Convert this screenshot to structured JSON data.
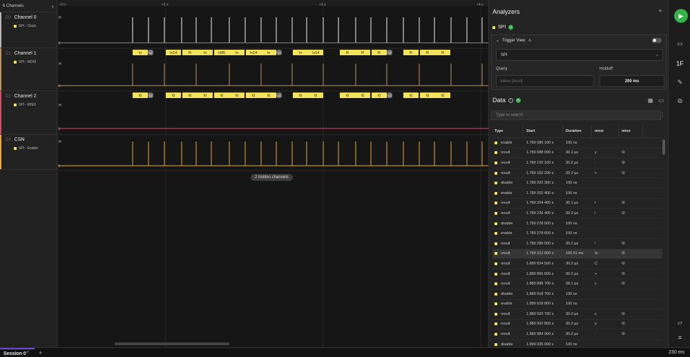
{
  "channels_header": {
    "count_label": "6 Channels",
    "collapse_icon": "chevron-left-icon"
  },
  "channels": [
    {
      "index": "D0",
      "name": "Channel 0",
      "analyzer": "SPI - Clock",
      "color": "#b8b8b8"
    },
    {
      "index": "D1",
      "name": "Channel 1",
      "analyzer": "SPI - MOSI",
      "color": "#c49860"
    },
    {
      "index": "D2",
      "name": "Channel 2",
      "analyzer": "SPI - MISO",
      "color": "#e04c64"
    },
    {
      "index": "D3",
      "name": "CSN",
      "analyzer": "SPI - Enable",
      "color": "#f0a93a"
    }
  ],
  "timeline": {
    "ticks": [
      "+0 s",
      "+2 s",
      "+3 s",
      "+4 s"
    ],
    "level_labels": {
      "high": "H",
      "low": "L"
    }
  },
  "mosi_frames": [
    "\\n",
    "\\x14",
    "R",
    "\\n",
    "\\x85",
    "\\n",
    "\\x14",
    "\\n",
    "\\n",
    "\\x14",
    "R",
    "R",
    "R",
    "R",
    "R",
    "R"
  ],
  "miso_frames": [
    "\\0",
    "\\0",
    "\\0",
    "\\0",
    "\\0",
    "\\0",
    "\\0",
    "\\0",
    "\\0",
    "\\0",
    "\\0",
    "\\0",
    "\\0",
    "\\0",
    "\\0",
    "\\0"
  ],
  "badge_label": "13",
  "hidden_channels_label": "2 hidden channels",
  "analyzers": {
    "title": "Analyzers",
    "add_icon": "plus-icon",
    "spi_label": "SPI",
    "trigger_view_label": "Trigger View",
    "trigger_select_value": "SPI",
    "query_label": "Query",
    "query_placeholder": "Value [Ascii]",
    "holdoff_label": "Holdoff",
    "holdoff_value": "200 ms"
  },
  "data_panel": {
    "title": "Data",
    "search_placeholder": "Type to search",
    "columns": [
      "Type",
      "Start",
      "Duration",
      "mosi",
      "miso"
    ],
    "rows": [
      {
        "type": "enable",
        "start": "1.789 086 100 s",
        "duration": "100 ns",
        "mosi": "",
        "miso": ""
      },
      {
        "type": "result",
        "start": "1.789 088 000 s",
        "duration": "30.2 µs",
        "mosi": "y",
        "miso": "\\0"
      },
      {
        "type": "result",
        "start": "1.789 120 100 s",
        "duration": "30.2 µs",
        "mosi": ".",
        "miso": "\\0"
      },
      {
        "type": "result",
        "start": "1.789 152 200 s",
        "duration": "30.2 µs",
        "mosi": "+",
        "miso": "\\0"
      },
      {
        "type": "disable",
        "start": "1.789 202 300 s",
        "duration": "100 ns",
        "mosi": "",
        "miso": ""
      },
      {
        "type": "enable",
        "start": "1.789 202 400 s",
        "duration": "100 ns",
        "mosi": "",
        "miso": ""
      },
      {
        "type": "result",
        "start": "1.789 204 400 s",
        "duration": "30.1 µs",
        "mosi": "r",
        "miso": "\\0"
      },
      {
        "type": "result",
        "start": "1.789 236 400 s",
        "duration": "30.2 µs",
        "mosi": "l",
        "miso": "\\0"
      },
      {
        "type": "disable",
        "start": "1.789 278 500 s",
        "duration": "100 ns",
        "mosi": "",
        "miso": ""
      },
      {
        "type": "enable",
        "start": "1.789 278 600 s",
        "duration": "100 ns",
        "mosi": "",
        "miso": ""
      },
      {
        "type": "result",
        "start": "1.789 280 500 s",
        "duration": "30.2 µs",
        "mosi": "!",
        "miso": "\\0"
      },
      {
        "type": "result",
        "start": "1.789 312 600 s",
        "duration": "100.51 ms",
        "mosi": "\\n",
        "miso": "\\0"
      },
      {
        "type": "result",
        "start": "1.889 824 500 s",
        "duration": "30.2 µs",
        "mosi": "C",
        "miso": "\\0"
      },
      {
        "type": "result",
        "start": "1.889 856 600 s",
        "duration": "30.2 µs",
        "mosi": "+",
        "miso": "\\0"
      },
      {
        "type": "result",
        "start": "1.889 888 700 s",
        "duration": "28.1 µs",
        "mosi": "c",
        "miso": "\\0"
      },
      {
        "type": "disable",
        "start": "1.889 918 700 s",
        "duration": "100 ns",
        "mosi": "",
        "miso": ""
      },
      {
        "type": "enable",
        "start": "1.889 918 800 s",
        "duration": "100 ns",
        "mosi": "",
        "miso": ""
      },
      {
        "type": "result",
        "start": "1.889 920 700 s",
        "duration": "30.2 µs",
        "mosi": "c",
        "miso": "\\0"
      },
      {
        "type": "result",
        "start": "1.889 952 800 s",
        "duration": "30.2 µs",
        "mosi": "y",
        "miso": "\\0"
      },
      {
        "type": "result",
        "start": "1.889 984 900 s",
        "duration": "30.2 µs",
        "mosi": ".",
        "miso": "\\0"
      },
      {
        "type": "disable",
        "start": "1.890 035 000 s",
        "duration": "100 ns",
        "mosi": "",
        "miso": ""
      }
    ],
    "selected_row": 11
  },
  "rail": {
    "icons": [
      "play-icon",
      "device-icon",
      "analyzer-icon",
      "measure-icon",
      "extensions-icon",
      "chat-icon",
      "menu-icon"
    ]
  },
  "bottom": {
    "session_label": "Session 0",
    "zoom_label": "230 ms"
  },
  "colors": {
    "accent": "#35b24a",
    "frame": "#f3e35b",
    "session_underline": "#6b4bd8"
  }
}
